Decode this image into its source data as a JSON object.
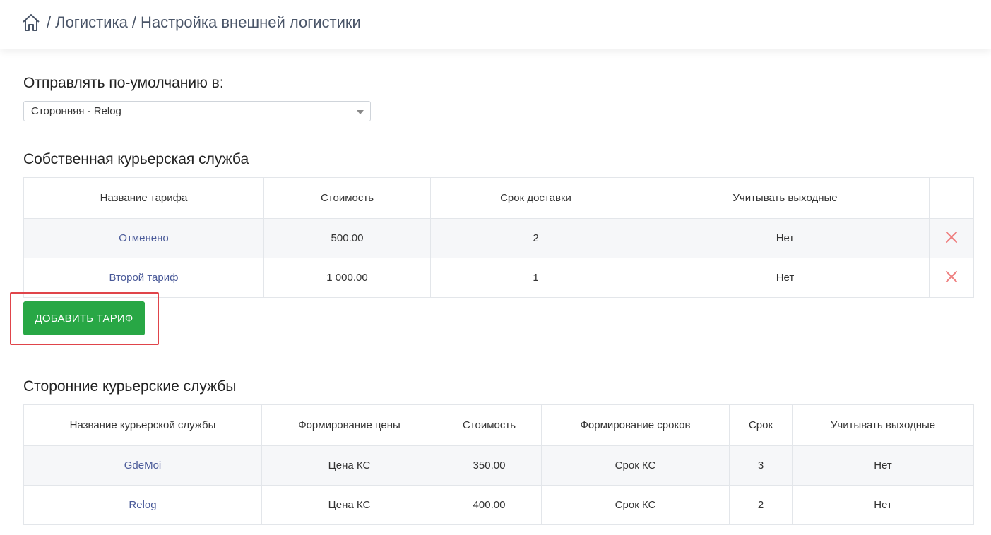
{
  "header": {
    "breadcrumb": [
      {
        "label": "Логистика"
      },
      {
        "label": "Настройка внешней логистики"
      }
    ],
    "separator": "/"
  },
  "default_send": {
    "label": "Отправлять по-умолчанию в:",
    "selected": "Сторонняя - Relog"
  },
  "own_service": {
    "title": "Собственная курьерская служба",
    "columns": [
      "Название тарифа",
      "Стоимость",
      "Срок доставки",
      "Учитывать выходные",
      ""
    ],
    "rows": [
      {
        "name": "Отменено",
        "cost": "500.00",
        "term": "2",
        "weekends": "Нет"
      },
      {
        "name": "Второй тариф",
        "cost": "1 000.00",
        "term": "1",
        "weekends": "Нет"
      }
    ],
    "add_button": "ДОБАВИТЬ ТАРИФ",
    "delete_color": "#ef7f7f"
  },
  "third_party": {
    "title": "Сторонние курьерские службы",
    "columns": [
      "Название курьерской службы",
      "Формирование цены",
      "Стоимость",
      "Формирование сроков",
      "Срок",
      "Учитывать выходные"
    ],
    "rows": [
      {
        "name": "GdeMoi",
        "price_mode": "Цена КС",
        "cost": "350.00",
        "term_mode": "Срок КС",
        "term": "3",
        "weekends": "Нет"
      },
      {
        "name": "Relog",
        "price_mode": "Цена КС",
        "cost": "400.00",
        "term_mode": "Срок КС",
        "term": "2",
        "weekends": "Нет"
      }
    ]
  },
  "colors": {
    "accent_green": "#28a745",
    "link": "#4a5a99",
    "highlight": "#e0444a"
  }
}
